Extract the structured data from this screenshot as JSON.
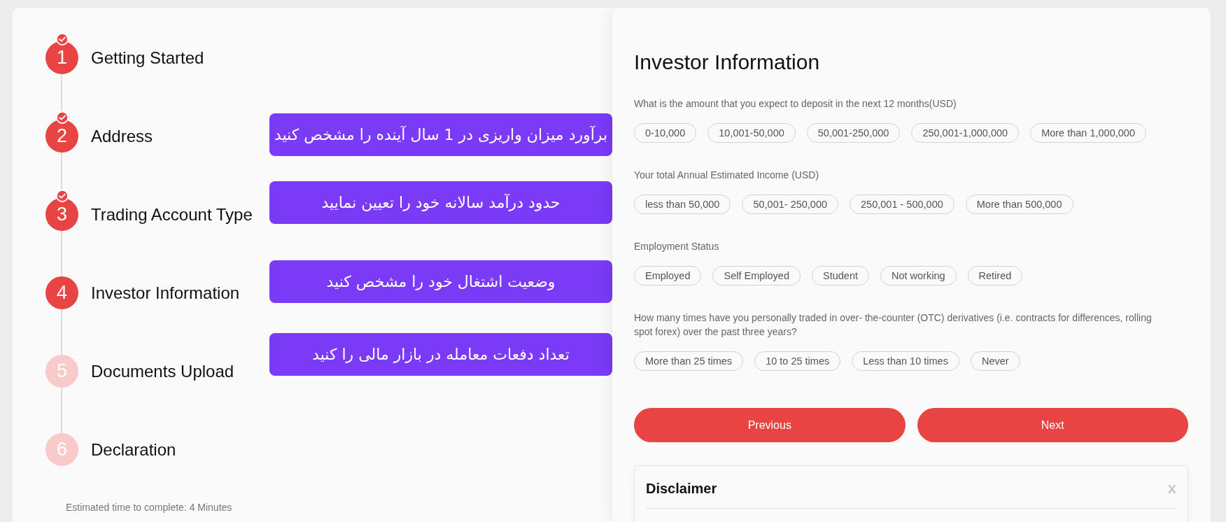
{
  "steps": [
    {
      "number": "1",
      "label": "Getting Started",
      "checked": true,
      "active": true
    },
    {
      "number": "2",
      "label": "Address",
      "checked": true,
      "active": true
    },
    {
      "number": "3",
      "label": "Trading Account Type",
      "checked": true,
      "active": true
    },
    {
      "number": "4",
      "label": "Investor Information",
      "checked": false,
      "active": true
    },
    {
      "number": "5",
      "label": "Documents Upload",
      "checked": false,
      "active": false
    },
    {
      "number": "6",
      "label": "Declaration",
      "checked": false,
      "active": false
    }
  ],
  "estimated_time": "Estimated time to complete: 4 Minutes",
  "annotations": [
    "برآورد میزان واریزی در 1 سال آینده را مشخص کنید",
    "حدود درآمد سالانه خود را تعیین نمایید",
    "وضعیت اشتغال خود را مشخص کنید",
    "تعداد دفعات معامله در بازار مالی را کنید"
  ],
  "form": {
    "title": "Investor Information",
    "questions": [
      {
        "label": "What is the amount that you expect to deposit in the next 12 months(USD)",
        "options": [
          {
            "label": "0-10,000",
            "selected": false
          },
          {
            "label": "10,001-50,000",
            "selected": false
          },
          {
            "label": "50,001-250,000",
            "selected": false
          },
          {
            "label": "250,001-1,000,000",
            "selected": false
          },
          {
            "label": "More than 1,000,000",
            "selected": false
          }
        ]
      },
      {
        "label": "Your total Annual Estimated Income (USD)",
        "options": [
          {
            "label": "less than 50,000",
            "selected": false
          },
          {
            "label": "50,001- 250,000",
            "selected": false
          },
          {
            "label": "250,001 - 500,000",
            "selected": false
          },
          {
            "label": "More than 500,000",
            "selected": false
          }
        ]
      },
      {
        "label": "Employment Status",
        "options": [
          {
            "label": "Employed",
            "selected": false
          },
          {
            "label": "Self Employed",
            "selected": false
          },
          {
            "label": "Student",
            "selected": false
          },
          {
            "label": "Not working",
            "selected": false
          },
          {
            "label": "Retired",
            "selected": false
          }
        ]
      },
      {
        "label": "How many times have you personally traded in over- the-counter (OTC) derivatives (i.e. contracts for differences, rolling spot forex) over the past three years?",
        "options": [
          {
            "label": "More than 25 times",
            "selected": false
          },
          {
            "label": "10 to 25 times",
            "selected": false
          },
          {
            "label": "Less than 10 times",
            "selected": false
          },
          {
            "label": "Never",
            "selected": false
          }
        ]
      }
    ]
  },
  "buttons": [
    "Previous",
    "Next"
  ],
  "disclaimer": {
    "title": "Disclaimer",
    "close": "x"
  }
}
